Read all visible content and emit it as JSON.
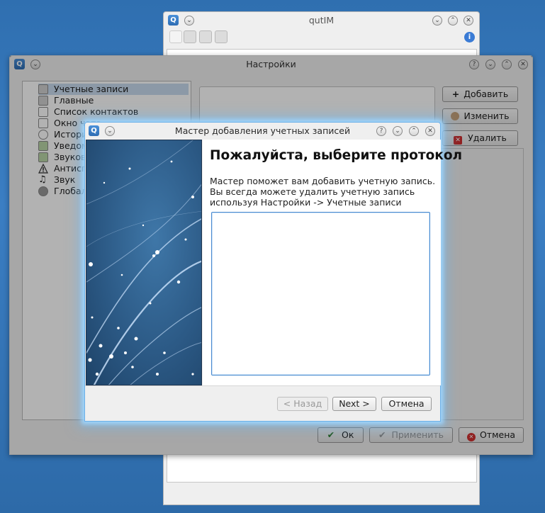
{
  "qutim": {
    "title": "qutIM",
    "toolbar_icons": [
      "contact-list-icon",
      "user-icon",
      "folder-icon",
      "flag-icon"
    ]
  },
  "settings": {
    "title": "Настройки",
    "tree": [
      {
        "label": "Учетные записи",
        "icon": "accounts-icon",
        "selected": true
      },
      {
        "label": "Главные",
        "icon": "general-icon"
      },
      {
        "label": "Список контактов",
        "icon": "contact-list-icon"
      },
      {
        "label": "Окно чата",
        "icon": "chat-window-icon"
      },
      {
        "label": "История",
        "icon": "history-icon"
      },
      {
        "label": "Уведом",
        "icon": "notifications-icon"
      },
      {
        "label": "Звуков",
        "icon": "sound-themes-icon"
      },
      {
        "label": "Антисп",
        "icon": "warning-icon"
      },
      {
        "label": "Звук",
        "icon": "music-note-icon"
      },
      {
        "label": "Глобал",
        "icon": "global-icon"
      }
    ],
    "buttons": {
      "add": "Добавить",
      "edit": "Изменить",
      "delete": "Удалить"
    },
    "footer": {
      "ok": "Ок",
      "apply": "Применить",
      "cancel": "Отмена"
    }
  },
  "wizard": {
    "title": "Мастер добавления учетных записей",
    "heading": "Пожалуйста, выберите протокол",
    "desc_line1": "Мастер поможет вам добавить учетную запись.",
    "desc_line2": "Вы всегда можете удалить учетную запись",
    "desc_line3": "используя Настройки -> Учетные записи",
    "back": "< Назад",
    "next": "Next >",
    "cancel": "Отмена"
  },
  "colors": {
    "desktop": "#3b7ec3",
    "wizard_glow": "#6cb0e8",
    "selection": "#c9dcef"
  }
}
